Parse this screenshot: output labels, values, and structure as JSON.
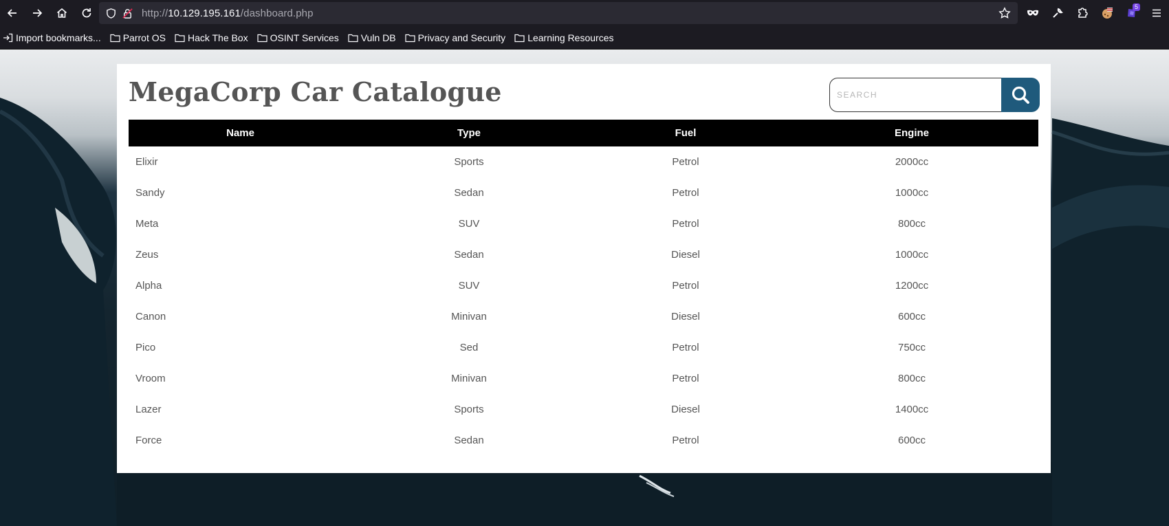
{
  "browser": {
    "url_scheme": "http://",
    "url_host": "10.129.195.161",
    "url_path": "/dashboard.php",
    "extension_badge": "5"
  },
  "bookmarks": [
    {
      "label": "Import bookmarks...",
      "icon": "import-icon"
    },
    {
      "label": "Parrot OS",
      "icon": "folder-icon"
    },
    {
      "label": "Hack The Box",
      "icon": "folder-icon"
    },
    {
      "label": "OSINT Services",
      "icon": "folder-icon"
    },
    {
      "label": "Vuln DB",
      "icon": "folder-icon"
    },
    {
      "label": "Privacy and Security",
      "icon": "folder-icon"
    },
    {
      "label": "Learning Resources",
      "icon": "folder-icon"
    }
  ],
  "page": {
    "title": "MegaCorp Car Catalogue",
    "search_placeholder": "SEARCH",
    "accent_color": "#1f5a7c"
  },
  "table": {
    "headers": [
      "Name",
      "Type",
      "Fuel",
      "Engine"
    ],
    "rows": [
      [
        "Elixir",
        "Sports",
        "Petrol",
        "2000cc"
      ],
      [
        "Sandy",
        "Sedan",
        "Petrol",
        "1000cc"
      ],
      [
        "Meta",
        "SUV",
        "Petrol",
        "800cc"
      ],
      [
        "Zeus",
        "Sedan",
        "Diesel",
        "1000cc"
      ],
      [
        "Alpha",
        "SUV",
        "Petrol",
        "1200cc"
      ],
      [
        "Canon",
        "Minivan",
        "Diesel",
        "600cc"
      ],
      [
        "Pico",
        "Sed",
        "Petrol",
        "750cc"
      ],
      [
        "Vroom",
        "Minivan",
        "Petrol",
        "800cc"
      ],
      [
        "Lazer",
        "Sports",
        "Diesel",
        "1400cc"
      ],
      [
        "Force",
        "Sedan",
        "Petrol",
        "600cc"
      ]
    ]
  }
}
